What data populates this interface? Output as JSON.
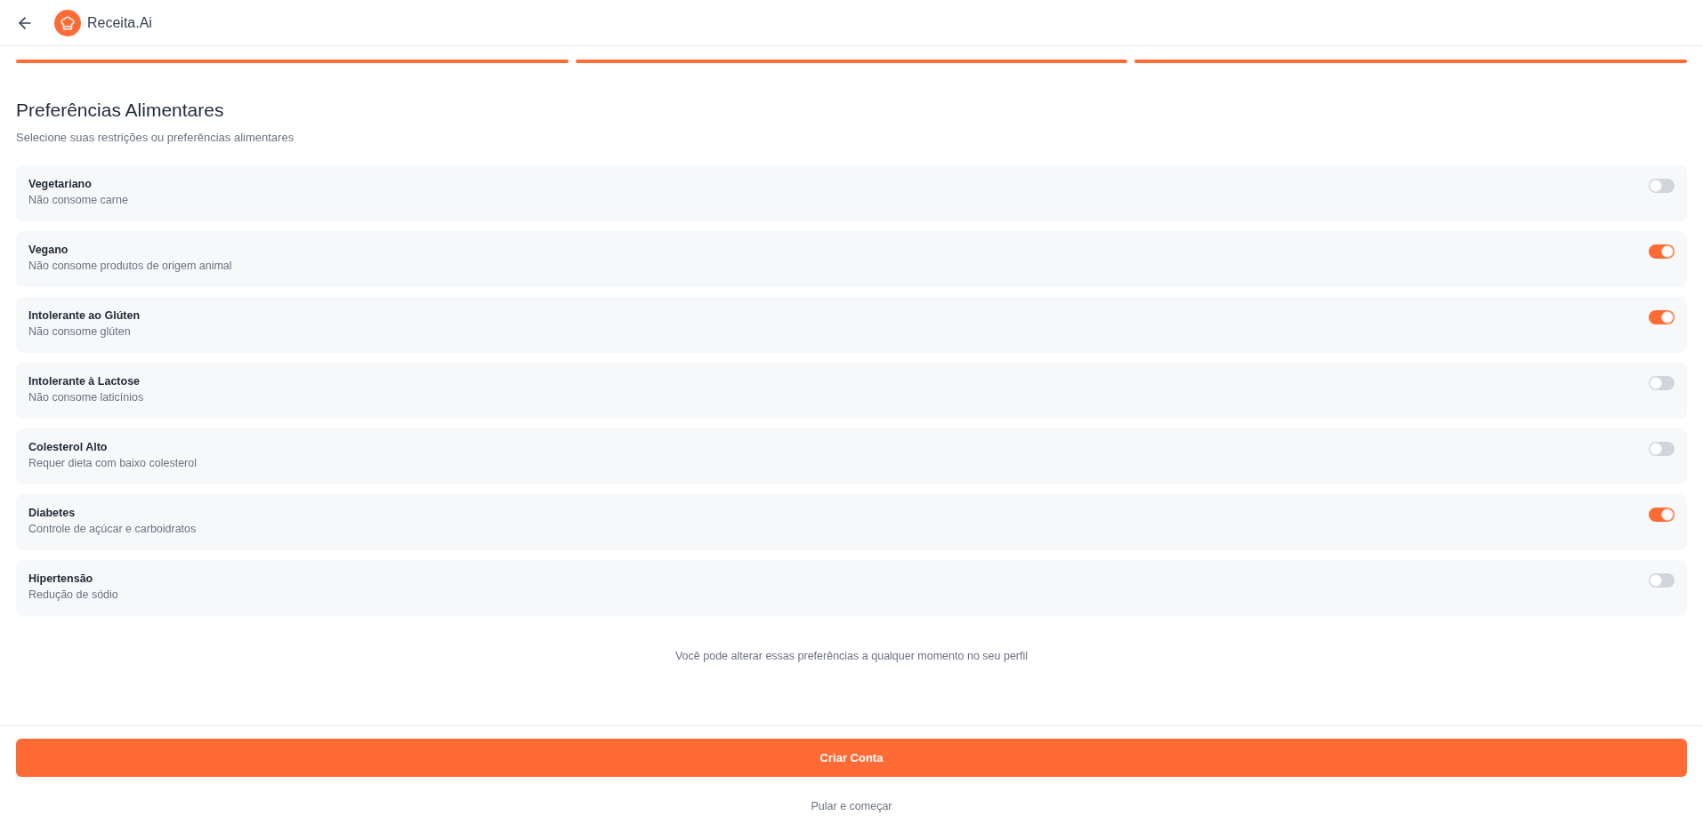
{
  "header": {
    "logo_text": "Receita.Ai"
  },
  "progress": {
    "steps": [
      {
        "completed": true
      },
      {
        "completed": true
      },
      {
        "completed": true
      }
    ]
  },
  "section": {
    "title": "Preferências Alimentares",
    "subtitle": "Selecione suas restrições ou preferências alimentares"
  },
  "preferences": [
    {
      "label": "Vegetariano",
      "description": "Não consome carne",
      "on": false
    },
    {
      "label": "Vegano",
      "description": "Não consome produtos de origem animal",
      "on": true
    },
    {
      "label": "Intolerante ao Glúten",
      "description": "Não consome glúten",
      "on": true
    },
    {
      "label": "Intolerante à Lactose",
      "description": "Não consome laticínios",
      "on": false
    },
    {
      "label": "Colesterol Alto",
      "description": "Requer dieta com baixo colesterol",
      "on": false
    },
    {
      "label": "Diabetes",
      "description": "Controle de açúcar e carboidratos",
      "on": true
    },
    {
      "label": "Hipertensão",
      "description": "Redução de sódio",
      "on": false
    }
  ],
  "note": "Você pode alterar essas preferências a qualquer momento no seu perfil",
  "footer": {
    "primary_button": "Criar Conta",
    "secondary_link": "Pular e começar"
  }
}
